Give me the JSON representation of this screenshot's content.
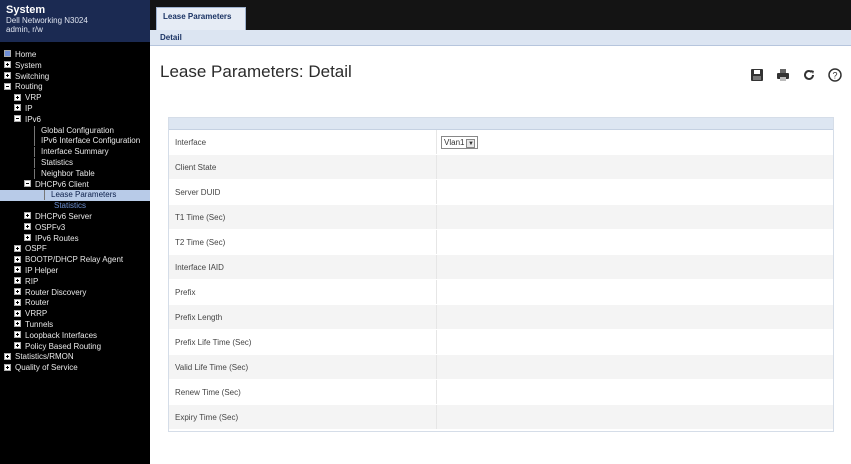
{
  "brand": {
    "name": "System",
    "line1": "Dell Networking N3024",
    "line2": "admin, r/w"
  },
  "sidebar": {
    "items": [
      {
        "label": "Home",
        "marker": "home",
        "indent": 0
      },
      {
        "label": "System",
        "marker": "plus",
        "indent": 0
      },
      {
        "label": "Switching",
        "marker": "plus",
        "indent": 0
      },
      {
        "label": "Routing",
        "marker": "minus",
        "indent": 0
      },
      {
        "label": "VRP",
        "marker": "plus",
        "indent": 1
      },
      {
        "label": "IP",
        "marker": "plus",
        "indent": 1
      },
      {
        "label": "IPv6",
        "marker": "minus",
        "indent": 1
      },
      {
        "label": "Global Configuration",
        "marker": "line",
        "indent": 3
      },
      {
        "label": "IPv6 Interface Configuration",
        "marker": "line",
        "indent": 3
      },
      {
        "label": "Interface Summary",
        "marker": "line",
        "indent": 3
      },
      {
        "label": "Statistics",
        "marker": "line",
        "indent": 3
      },
      {
        "label": "Neighbor Table",
        "marker": "line",
        "indent": 3
      },
      {
        "label": "DHCPv6 Client",
        "marker": "minus",
        "indent": 2
      },
      {
        "label": "Lease Parameters",
        "marker": "line",
        "indent": 4,
        "state": "selected"
      },
      {
        "label": "Statistics",
        "marker": "none",
        "indent": 5,
        "state": "sub-selected"
      },
      {
        "label": "DHCPv6 Server",
        "marker": "plus",
        "indent": 2
      },
      {
        "label": "OSPFv3",
        "marker": "plus",
        "indent": 2
      },
      {
        "label": "IPv6 Routes",
        "marker": "plus",
        "indent": 2
      },
      {
        "label": "OSPF",
        "marker": "plus",
        "indent": 1
      },
      {
        "label": "BOOTP/DHCP Relay Agent",
        "marker": "plus",
        "indent": 1
      },
      {
        "label": "IP Helper",
        "marker": "plus",
        "indent": 1
      },
      {
        "label": "RIP",
        "marker": "plus",
        "indent": 1
      },
      {
        "label": "Router Discovery",
        "marker": "plus",
        "indent": 1
      },
      {
        "label": "Router",
        "marker": "plus",
        "indent": 1
      },
      {
        "label": "VRRP",
        "marker": "plus",
        "indent": 1
      },
      {
        "label": "Tunnels",
        "marker": "plus",
        "indent": 1
      },
      {
        "label": "Loopback Interfaces",
        "marker": "plus",
        "indent": 1
      },
      {
        "label": "Policy Based Routing",
        "marker": "plus",
        "indent": 1
      },
      {
        "label": "Statistics/RMON",
        "marker": "plus",
        "indent": 0
      },
      {
        "label": "Quality of Service",
        "marker": "plus",
        "indent": 0
      }
    ]
  },
  "tabs": {
    "active": "Lease Parameters",
    "sub": "Detail"
  },
  "page": {
    "title": "Lease Parameters: Detail"
  },
  "toolbar": {
    "save_icon": "save-icon",
    "print_icon": "print-icon",
    "refresh_icon": "refresh-icon",
    "help_icon": "help-icon"
  },
  "form": {
    "rows": [
      {
        "label": "Interface",
        "value": "",
        "type": "select",
        "selected": "Vlan1"
      },
      {
        "label": "Client State",
        "value": ""
      },
      {
        "label": "Server DUID",
        "value": ""
      },
      {
        "label": "T1 Time (Sec)",
        "value": ""
      },
      {
        "label": "T2 Time (Sec)",
        "value": ""
      },
      {
        "label": "Interface IAID",
        "value": ""
      },
      {
        "label": "Prefix",
        "value": ""
      },
      {
        "label": "Prefix Length",
        "value": ""
      },
      {
        "label": "Prefix Life Time (Sec)",
        "value": ""
      },
      {
        "label": "Valid Life Time (Sec)",
        "value": ""
      },
      {
        "label": "Renew Time (Sec)",
        "value": ""
      },
      {
        "label": "Expiry Time (Sec)",
        "value": ""
      }
    ]
  }
}
